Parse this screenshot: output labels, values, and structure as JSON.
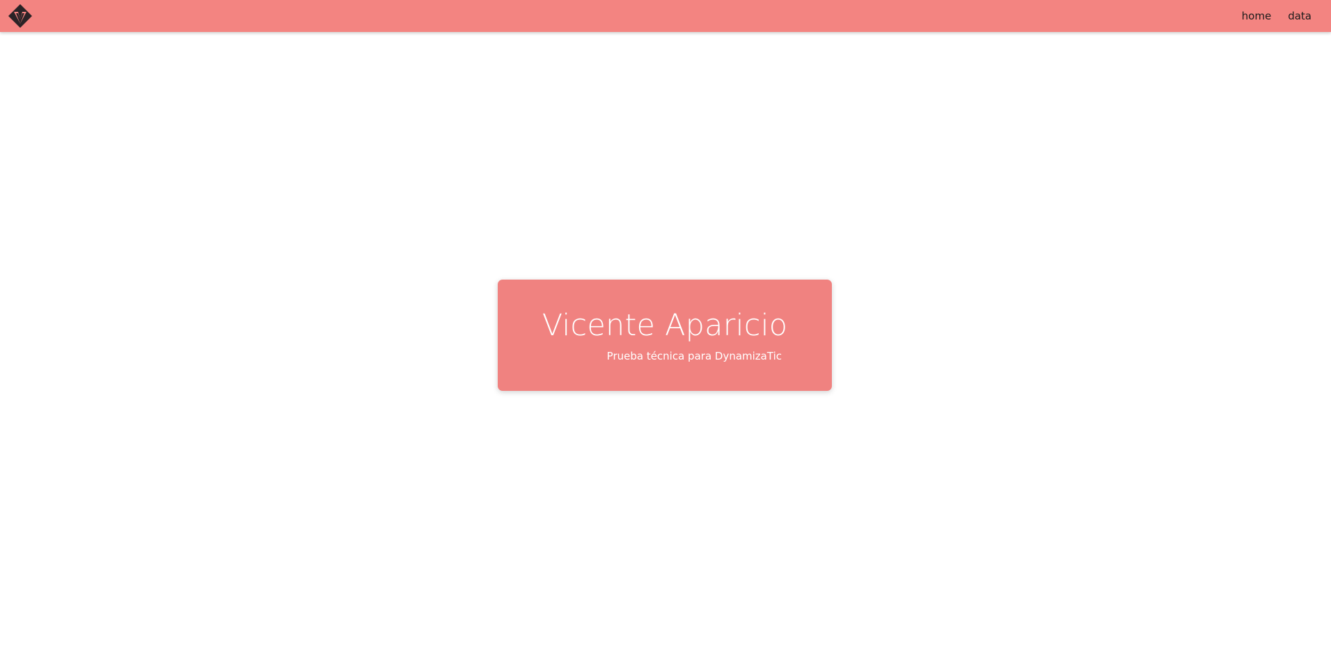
{
  "navbar": {
    "logo_icon": "diamond-v-logo-icon",
    "background_color": "#f38481",
    "links": [
      {
        "label": "home"
      },
      {
        "label": "data"
      }
    ]
  },
  "hero": {
    "name": "Vicente Aparicio",
    "subtitle": "Prueba técnica para DynamizaTic",
    "background_color": "#f08280",
    "text_color": "#ffffff"
  }
}
